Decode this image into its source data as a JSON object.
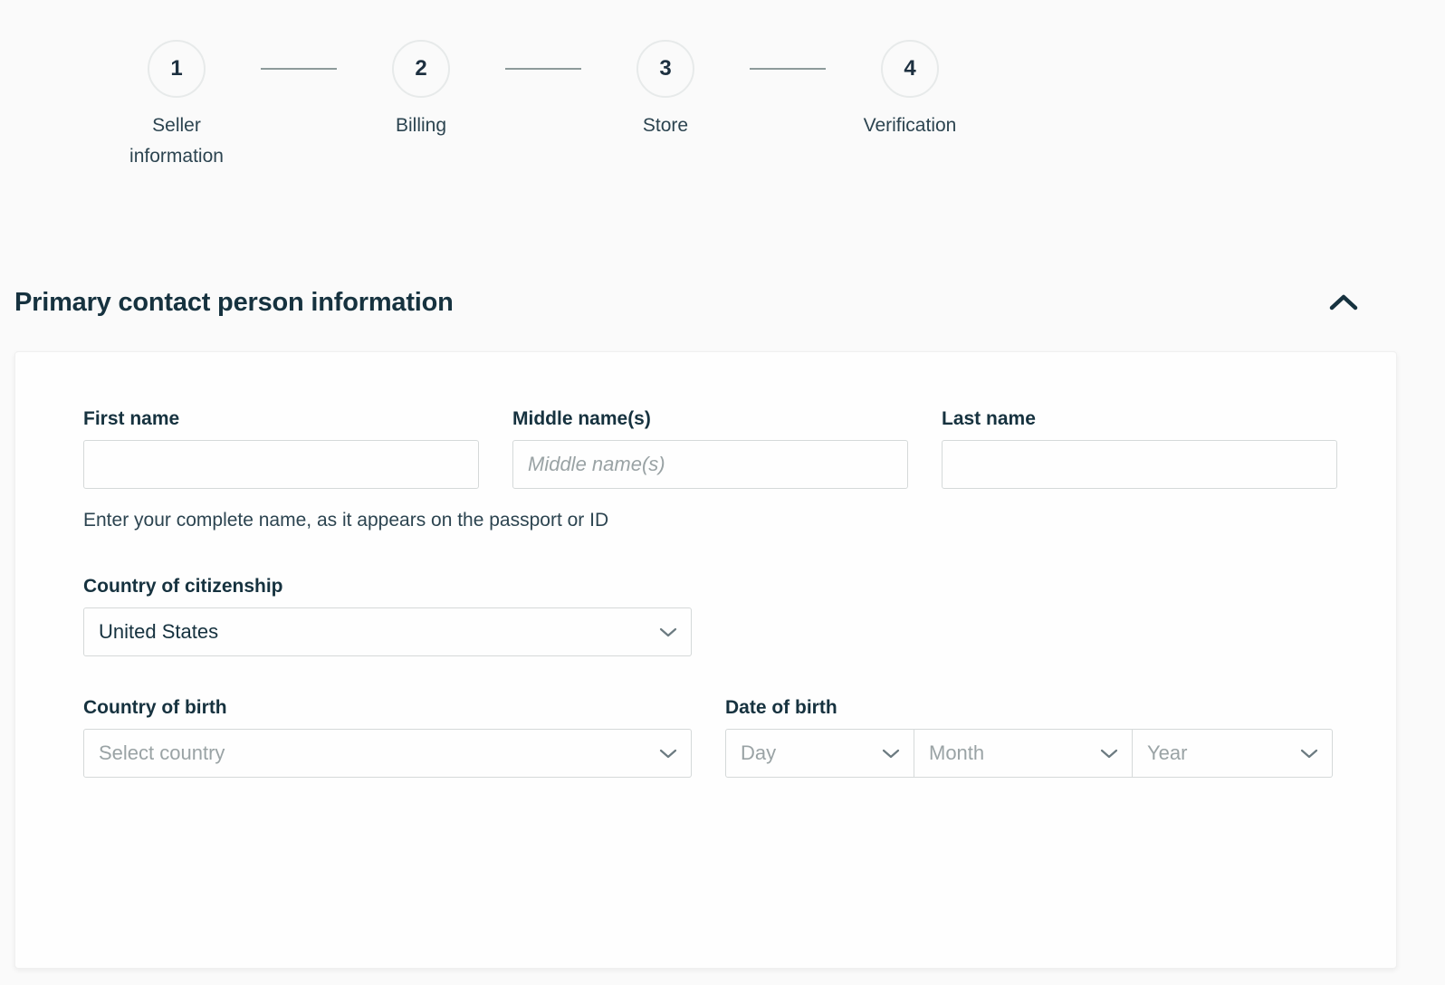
{
  "stepper": {
    "steps": [
      {
        "number": "1",
        "label": "Seller information"
      },
      {
        "number": "2",
        "label": "Billing"
      },
      {
        "number": "3",
        "label": "Store"
      },
      {
        "number": "4",
        "label": "Verification"
      }
    ],
    "active_step": 1
  },
  "section": {
    "title": "Primary contact person information",
    "toggle_icon": "chevron-up-icon",
    "expanded": true
  },
  "form": {
    "first_name": {
      "label": "First name",
      "value": "",
      "placeholder": ""
    },
    "middle_name": {
      "label": "Middle name(s)",
      "value": "",
      "placeholder": "Middle name(s)"
    },
    "last_name": {
      "label": "Last name",
      "value": "",
      "placeholder": ""
    },
    "name_helper_text": "Enter your complete name, as it appears on the passport or ID",
    "country_of_citizenship": {
      "label": "Country of citizenship",
      "value": "United States",
      "icon": "chevron-down-icon"
    },
    "country_of_birth": {
      "label": "Country of birth",
      "value": "",
      "placeholder": "Select country",
      "icon": "chevron-down-icon"
    },
    "date_of_birth": {
      "label": "Date of birth",
      "day": {
        "placeholder": "Day",
        "value": "",
        "icon": "chevron-down-icon"
      },
      "month": {
        "placeholder": "Month",
        "value": "",
        "icon": "chevron-down-icon"
      },
      "year": {
        "placeholder": "Year",
        "value": "",
        "icon": "chevron-down-icon"
      }
    }
  },
  "colors": {
    "page_background": "#fafafa",
    "card_background": "#fefefe",
    "text_dark": "#16323f",
    "text_muted": "#2c4450",
    "placeholder": "#9aa3a5",
    "input_border": "#d5d9d9",
    "step_circle_border": "#e7eaea",
    "connector": "#8d9a9a"
  }
}
